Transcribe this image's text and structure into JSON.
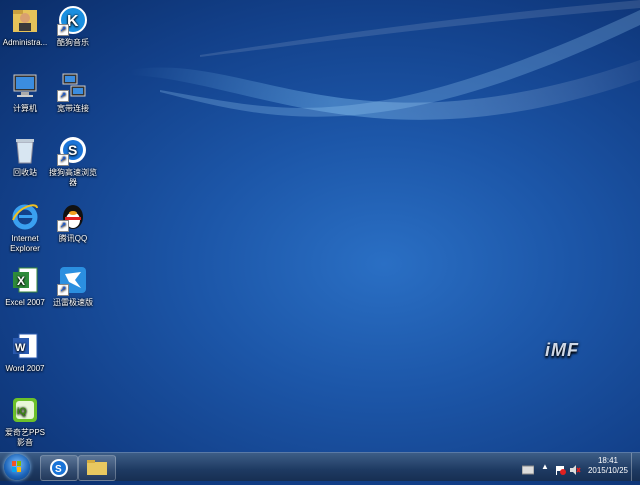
{
  "desktop": {
    "icons": [
      {
        "label": "Administra..."
      },
      {
        "label": "酷狗音乐"
      },
      {
        "label": "计算机"
      },
      {
        "label": "宽带连接"
      },
      {
        "label": "回收站"
      },
      {
        "label": "搜狗高速浏览器"
      },
      {
        "label": "Internet Explorer"
      },
      {
        "label": "腾讯QQ"
      },
      {
        "label": "Excel 2007"
      },
      {
        "label": "迅雷极速版"
      },
      {
        "label": "Word 2007"
      },
      {
        "label": "爱奇艺PPS 影音"
      }
    ],
    "logo_text": "iMF"
  },
  "taskbar": {
    "clock_time": "18:41",
    "clock_date": "2015/10/25"
  }
}
